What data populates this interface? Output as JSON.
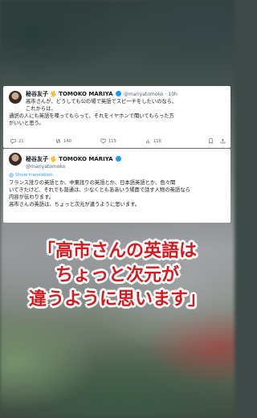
{
  "tweet1": {
    "author_name": "秘谷友子",
    "author_emoji": "🖖",
    "author_latin": "TOMOKO MARIYA",
    "handle": "@mariyatomoko",
    "time": "· 10h",
    "text_lines": [
      "高市さんが、どうしても公の場で英語でスピーチをしたいのなら、",
      "これからは、",
      "通訳の人にも英語を喋ってもらって、それをイヤホンで聞いてもらった方",
      "がいいと思う。"
    ],
    "stats": {
      "replies": "21",
      "reposts": "140",
      "likes": "115",
      "views": "11K"
    }
  },
  "tweet2": {
    "author_name": "秘谷友子",
    "author_emoji": "🖖",
    "author_latin": "TOMOKO MARIYA",
    "handle": "@mariyatomoko",
    "show_translation": "Show translation",
    "text_lines": [
      "フランス訛りの英語とか、中東訛りの英語とか、日本語英語とか、色々聞",
      "いてきたけど、それでも普通は、少なくともああいう場面で話す人物の英語なら",
      "内容が伝わります。",
      "高市さんの英語は、ちょっと次元が違うように思います。"
    ]
  },
  "caption": {
    "line1": "「高市さんの英語は",
    "line2": "ちょっと次元が",
    "line3": "違うように思います」"
  },
  "colors": {
    "caption_red": "#d7181c",
    "link_blue": "#1d9bf0",
    "muted_gray": "#536471"
  }
}
